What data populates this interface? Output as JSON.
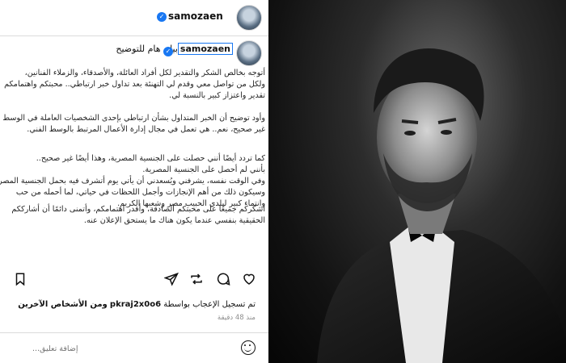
{
  "header": {
    "username": "samozaen"
  },
  "caption": {
    "username": "samozaen",
    "title": "بيان هام للتوضيح",
    "p1": [
      "أتوجه بخالص الشكر والتقدير لكل أفراد العائلة، والأصدقاء، والزملاء الفنانين،",
      "ولكل من تواصل معي وقدم لي التهنئة بعد تداول خبر ارتباطي.. محبتكم واهتمامكم",
      "تقدير واعتزاز كبير بالنسبة لي."
    ],
    "p2": [
      "وأود توضيح أن الخبر المتداول بشأن ارتباطي بإحدى الشخصيات العاملة في الوسط",
      "غير صحيح، نعم.. هي تعمل في مجال إدارة الأعمال المرتبط بالوسط الفني."
    ],
    "p3": [
      "كما تردد أيضًا أنني حصلت على الجنسية المصرية، وهذا أيضًا غير صحيح..",
      "بأنني لم أحصل على الجنسية المصرية.",
      "وفي الوقت نفسه، يشرفني ويُسعدني أن يأتي يوم أتشرف فيه بحمل الجنسية المصرية،",
      "وسيكون ذلك من أهم الإنجازات وأجمل اللحظات في حياتي، لما أحمله من حب",
      "وانتماء كبير لبلدي الحبيب مصر وشعبها الكريم."
    ],
    "p4": [
      "أشكركم جميعًا على محبتكم الصادقة، وأقدر اهتمامكم، وأتمنى دائمًا أن أشارككم",
      "الحقيقية بنفسي عندما يكون هناك ما يستحق الإعلان عنه."
    ]
  },
  "likes": {
    "prefix": "تم تسجيل الإعجاب بواسطة",
    "user": "pkraj2x0o6",
    "suffix": "ومن الأشخاص الآخرين"
  },
  "time_ago": "منذ 48 دقيقة",
  "comment": {
    "placeholder": "إضافة تعليق..."
  },
  "icons": [
    "heart-icon",
    "comment-icon",
    "repost-icon",
    "share-icon",
    "bookmark-icon",
    "emoji-icon",
    "verified-icon"
  ]
}
